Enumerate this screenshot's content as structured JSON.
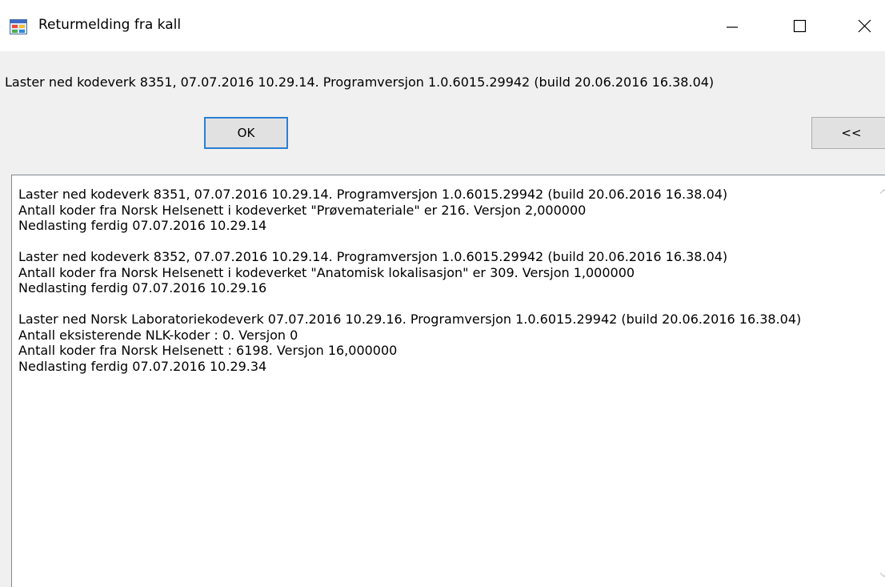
{
  "window": {
    "title": "Returmelding fra kall",
    "icon": "application-window-icon"
  },
  "controls": {
    "minimize_icon": "minimize-icon",
    "maximize_icon": "maximize-icon",
    "close_icon": "close-icon"
  },
  "header": {
    "message": "Laster ned kodeverk 8351, 07.07.2016 10.29.14. Programversjon 1.0.6015.29942 (build 20.06.2016 16.38.04)"
  },
  "buttons": {
    "ok_label": "OK",
    "collapse_label": "<<"
  },
  "log": {
    "text": "Laster ned kodeverk 8351, 07.07.2016 10.29.14. Programversjon 1.0.6015.29942 (build 20.06.2016 16.38.04)\nAntall koder fra Norsk Helsenett i kodeverket \"Prøvemateriale\" er 216. Versjon 2,000000\nNedlasting ferdig 07.07.2016 10.29.14\n\nLaster ned kodeverk 8352, 07.07.2016 10.29.14. Programversjon 1.0.6015.29942 (build 20.06.2016 16.38.04)\nAntall koder fra Norsk Helsenett i kodeverket \"Anatomisk lokalisasjon\" er 309. Versjon 1,000000\nNedlasting ferdig 07.07.2016 10.29.16\n\nLaster ned Norsk Laboratoriekodeverk 07.07.2016 10.29.16. Programversjon 1.0.6015.29942 (build 20.06.2016 16.38.04)\nAntall eksisterende NLK-koder : 0. Versjon 0\nAntall koder fra Norsk Helsenett : 6198. Versjon 16,000000\nNedlasting ferdig 07.07.2016 10.29.34"
  },
  "colors": {
    "titlebar": "#ffffff",
    "client_background": "#f0f0f0",
    "button_face": "#e1e1e1",
    "focus_border": "#2b7fd3"
  }
}
